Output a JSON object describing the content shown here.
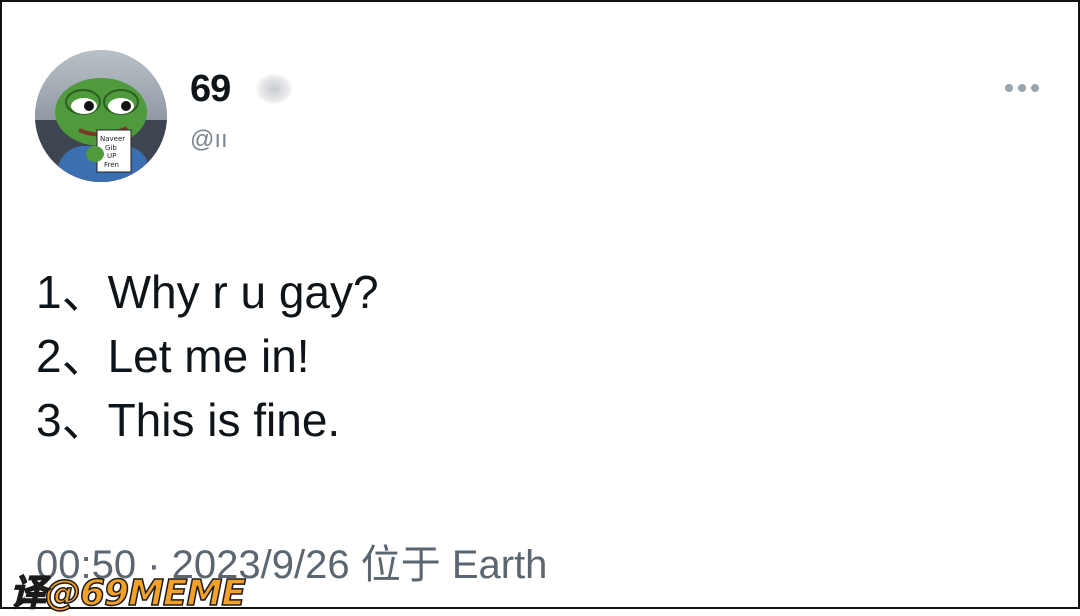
{
  "author": {
    "display_name": "69",
    "handle": "@ıı",
    "avatar_sign_text": [
      "Naveer",
      "Gib",
      "UP",
      "Fren"
    ]
  },
  "more_button": {
    "icon": "more-horizontal-icon"
  },
  "tweet": {
    "lines": [
      "1、Why r u gay?",
      "2、Let me in!",
      "3、This is fine."
    ]
  },
  "meta": {
    "timestamp": "00:50 · 2023/9/26 位于 Earth"
  },
  "watermark": "译@69MEME",
  "colors": {
    "text": "#0f1419",
    "secondary": "#5b6670",
    "watermark": "#f4a12a",
    "frog_green": "#4f9a3c"
  }
}
